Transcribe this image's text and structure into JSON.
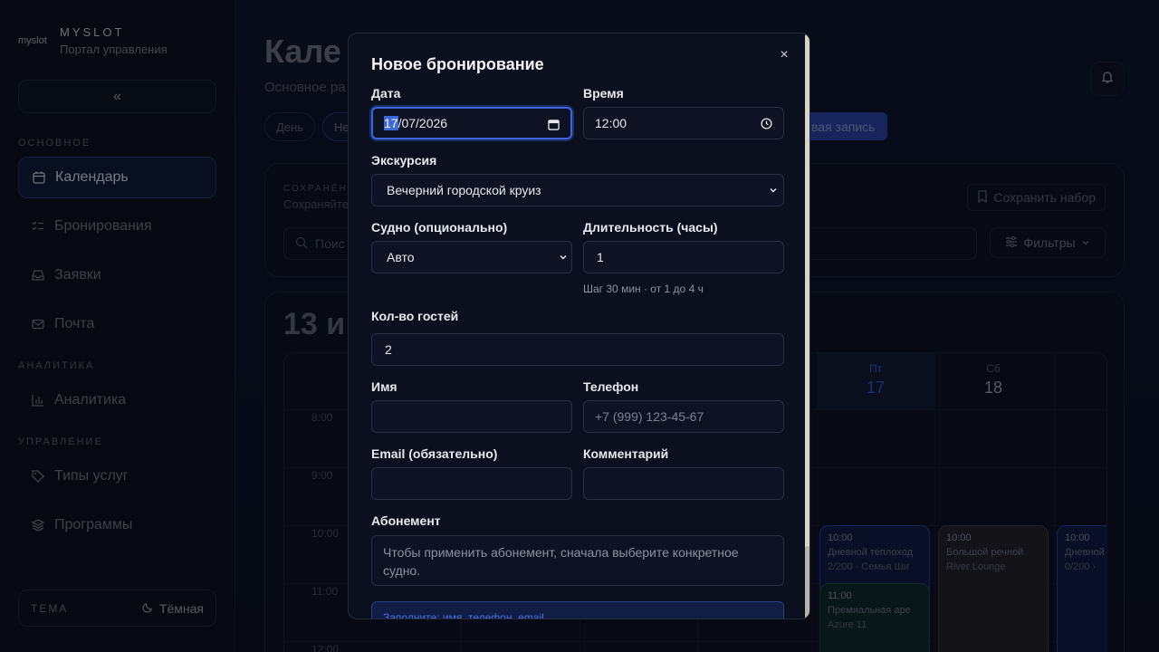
{
  "brand": {
    "logo": "myslot",
    "name": "MYSLOT",
    "subtitle": "Портал управления"
  },
  "sidebar": {
    "collapse_icon": "«",
    "sections": {
      "main": "ОСНОВНОЕ",
      "analytics": "АНАЛИТИКА",
      "management": "УПРАВЛЕНИЕ"
    },
    "items": [
      {
        "label": "Календарь",
        "icon": "calendar-icon",
        "active": true
      },
      {
        "label": "Бронирования",
        "icon": "list-check-icon"
      },
      {
        "label": "Заявки",
        "icon": "inbox-icon"
      },
      {
        "label": "Почта",
        "icon": "mail-icon"
      },
      {
        "label": "Аналитика",
        "icon": "bar-chart-icon"
      },
      {
        "label": "Типы услуг",
        "icon": "tag-icon"
      },
      {
        "label": "Программы",
        "icon": "layers-icon"
      }
    ],
    "theme": {
      "label": "ТЕМА",
      "value": "Тёмная",
      "icon": "moon-icon"
    }
  },
  "main": {
    "title": "Кале",
    "subtitle": "Основное ра",
    "views": [
      "День",
      "Не"
    ],
    "new_entry": "вая запись",
    "saved": {
      "label": "СОХРАНЁН",
      "hint": "Сохраняйте",
      "save_button": "Сохранить набор"
    },
    "search_placeholder": "Поис",
    "filters": "Фильтры",
    "calendar": {
      "title": "13 и",
      "times": [
        "8:00",
        "9:00",
        "10:00",
        "11:00",
        "12:00"
      ],
      "days": [
        {
          "dow": "Пт",
          "num": "17",
          "today": true
        },
        {
          "dow": "Сб",
          "num": "18",
          "today": false
        }
      ],
      "events": [
        {
          "time": "10:00",
          "name": "Дневной теплоход",
          "sub": "2/200 · Семья Ши",
          "style": "blue"
        },
        {
          "time": "11:00",
          "name": "Премиальная аре",
          "sub": "Azure 11",
          "style": "teal"
        },
        {
          "time": "10:00",
          "name": "Большой речной ",
          "sub": "River Lounge",
          "style": "gray"
        },
        {
          "time": "10:00",
          "name": "Дневной",
          "sub": "0/200 ·",
          "style": "blue"
        }
      ]
    }
  },
  "modal": {
    "title": "Новое бронирование",
    "close_icon": "×",
    "date": {
      "label": "Дата",
      "day": "17",
      "rest": "/07/2026",
      "icon": "calendar-icon"
    },
    "time": {
      "label": "Время",
      "value": "12:00",
      "icon": "clock-icon"
    },
    "excursion": {
      "label": "Экскурсия",
      "value": "Вечерний городской круиз"
    },
    "vessel": {
      "label": "Судно (опционально)",
      "value": "Авто"
    },
    "duration": {
      "label": "Длительность (часы)",
      "value": "1",
      "hint": "Шаг 30 мин · от 1 до 4 ч"
    },
    "guests": {
      "label": "Кол-во гостей",
      "value": "2"
    },
    "name": {
      "label": "Имя",
      "value": ""
    },
    "phone": {
      "label": "Телефон",
      "placeholder": "+7 (999) 123-45-67"
    },
    "email": {
      "label": "Email (обязательно)",
      "value": ""
    },
    "comment": {
      "label": "Комментарий",
      "value": ""
    },
    "subscription": {
      "label": "Абонемент",
      "text": "Чтобы применить абонемент, сначала выберите конкретное судно."
    },
    "notice": "Заполните: имя, телефон, email"
  }
}
